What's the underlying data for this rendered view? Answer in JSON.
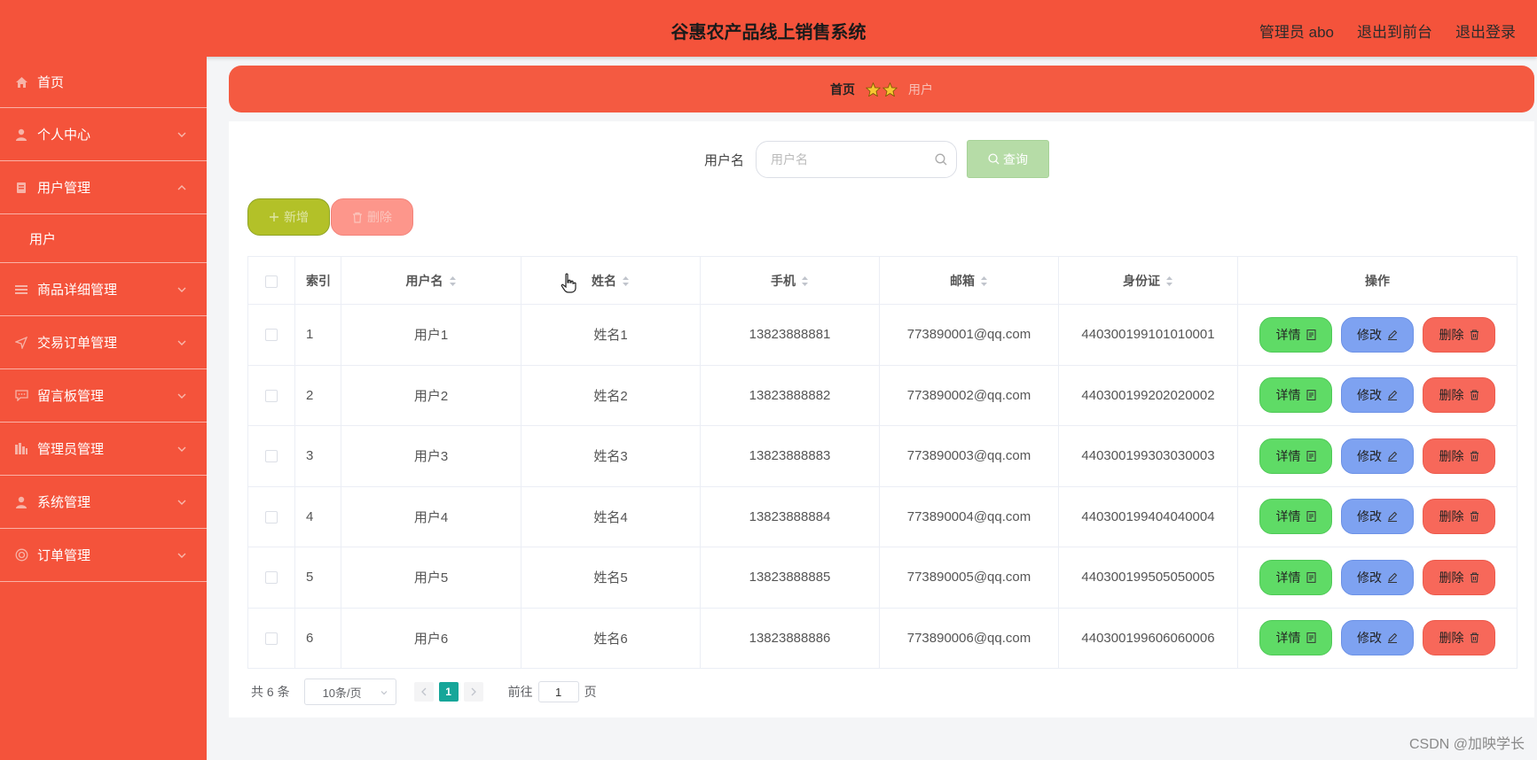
{
  "header": {
    "title": "谷惠农产品线上销售系统",
    "user": "管理员 abo",
    "to_front": "退出到前台",
    "logout": "退出登录"
  },
  "sidebar": {
    "items": [
      {
        "label": "首页",
        "icon": "home-icon"
      },
      {
        "label": "个人中心",
        "icon": "user-icon"
      },
      {
        "label": "用户管理",
        "icon": "user-manage-icon",
        "expanded": true
      },
      {
        "label": "用户",
        "sub": true
      },
      {
        "label": "商品详细管理",
        "icon": "list-icon"
      },
      {
        "label": "交易订单管理",
        "icon": "send-icon"
      },
      {
        "label": "留言板管理",
        "icon": "chat-icon"
      },
      {
        "label": "管理员管理",
        "icon": "chart-icon"
      },
      {
        "label": "系统管理",
        "icon": "user-icon"
      },
      {
        "label": "订单管理",
        "icon": "order-icon"
      }
    ]
  },
  "breadcrumb": {
    "home": "首页",
    "current": "用户"
  },
  "search": {
    "label": "用户名",
    "placeholder": "用户名",
    "button": "查询"
  },
  "actions": {
    "add": "新增",
    "delete": "删除"
  },
  "table": {
    "headers": [
      "索引",
      "用户名",
      "姓名",
      "手机",
      "邮箱",
      "身份证",
      "操作"
    ],
    "rows": [
      {
        "index": "1",
        "username": "用户1",
        "name": "姓名1",
        "phone": "13823888881",
        "email": "773890001@qq.com",
        "id_card": "440300199101010001"
      },
      {
        "index": "2",
        "username": "用户2",
        "name": "姓名2",
        "phone": "13823888882",
        "email": "773890002@qq.com",
        "id_card": "440300199202020002"
      },
      {
        "index": "3",
        "username": "用户3",
        "name": "姓名3",
        "phone": "13823888883",
        "email": "773890003@qq.com",
        "id_card": "440300199303030003"
      },
      {
        "index": "4",
        "username": "用户4",
        "name": "姓名4",
        "phone": "13823888884",
        "email": "773890004@qq.com",
        "id_card": "440300199404040004"
      },
      {
        "index": "5",
        "username": "用户5",
        "name": "姓名5",
        "phone": "13823888885",
        "email": "773890005@qq.com",
        "id_card": "440300199505050005"
      },
      {
        "index": "6",
        "username": "用户6",
        "name": "姓名6",
        "phone": "13823888886",
        "email": "773890006@qq.com",
        "id_card": "440300199606060006"
      }
    ],
    "op_detail": "详情",
    "op_edit": "修改",
    "op_delete": "删除"
  },
  "pagination": {
    "total": "共 6 条",
    "page_size": "10条/页",
    "current_page": "1",
    "goto_prefix": "前往",
    "goto_value": "1",
    "goto_suffix": "页"
  },
  "watermark": "CSDN @加映学长",
  "colors": {
    "primary": "#f4533b",
    "detail": "#5fdb66",
    "edit": "#7ea2f1",
    "delete": "#f7685a",
    "add": "#b3c128",
    "page_active": "#16a699"
  }
}
